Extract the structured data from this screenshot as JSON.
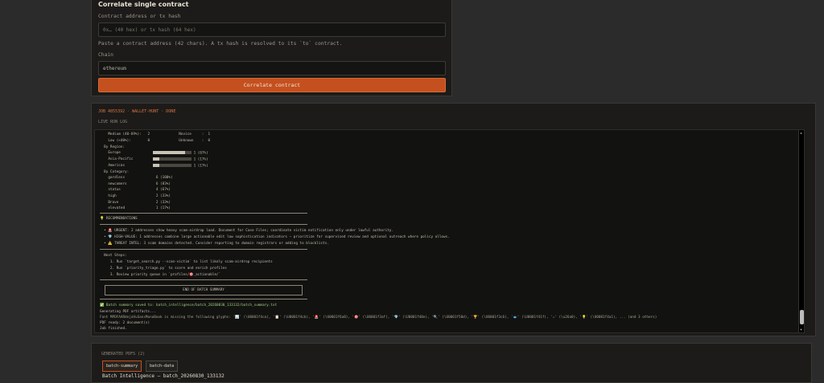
{
  "correlate": {
    "title": "Correlate single contract",
    "address_label": "Contract address or tx hash",
    "address_placeholder": "0x… (40 hex) or tx hash (64 hex)",
    "hint": "Paste a contract address (42 chars). A tx hash is resolved to its `to` contract.",
    "chain_label": "Chain",
    "chain_value": "ethereum",
    "button_label": "Correlate contract"
  },
  "job": {
    "status": "JOB 4855392 · WALLET-HUNT · DONE",
    "log_title": "LIVE RUN LOG",
    "log": {
      "lines": [
        "    Medium (40-69%):   2              Novice     :  1",
        "    Low (<40%):        0              Unknown    :  0",
        "  By Region:",
        "    Europe",
        "    Asia-Pacific",
        "    Americas",
        "  By Category:",
        "    gardless               6 (100%)",
        "    newcomers              6 (83%)",
        "    status                 4 (67%)",
        "    high                   2 (33%)",
        "    Brave                  2 (33%)",
        "    elevated               1 (17%)"
      ],
      "region_bars": [
        {
          "level": 0.83,
          "text": "1 (67%)"
        },
        {
          "level": 0.17,
          "text": "1 (17%)"
        },
        {
          "level": 0.17,
          "text": "1 (17%)"
        }
      ],
      "rec_title": "💡 RECOMMENDATIONS",
      "recs": [
        "  • 🚨 URGENT: 2 addresses show heavy scam-airdrop load. Document for Case Files; coordinate victim notification only under lawful authority.",
        "  • 💎 HIGH-VALUE: 1 addresses combine large actionable edit low sophistication indicators — prioritize for supervised review and optional outreach where policy allows.",
        "  • ⚠️ THREAT INTEL: 3 scam domains detected. Consider reporting to domain registrars or adding to blocklists."
      ],
      "next_title": "  Next Steps:",
      "next": [
        "     1. Run `target_search.py --scan-victim` to list likely scam-airdrop recipients",
        "     2. Run `priority_triage.py` to score and enrich profiles",
        "     3. Review priority queue in `profiles/🎯_actionable/`"
      ],
      "end_banner": "END OF BATCH SUMMARY",
      "tail": [
        "✅ Batch summary saved to: batch_intelligence/batch_20260830_133132/batch_summary.txt",
        "Generating PDF artifacts...",
        "Font MPDFAARdejaVuSansMonoBook is missing the following glyphs: '📊' (\\U0001f4ca), '📋' (\\U0001f4cb), '🚨' (\\U0001f6a8), '🎯' (\\U0001f3af), '💎' (\\U0001f48e), '🔍' (\\U0001f50d), '🏆' (\\U0001f3c6), '🐟' (\\U0001f41f), '⚠' (\\u26a0), '💡' (\\U0001f4a1), ... (and 3 others)",
        "PDF ready: 2 document(s)",
        "Job finished."
      ]
    }
  },
  "pdfs": {
    "title": "GENERATED PDFS (2)",
    "tabs": [
      "batch-summary",
      "batch-data"
    ],
    "preview": "Batch Intelligence — batch_20260830_133132"
  },
  "colors": {
    "accent": "#c4501f",
    "job_status": "#d8733e",
    "success": "#7fbf5a"
  }
}
